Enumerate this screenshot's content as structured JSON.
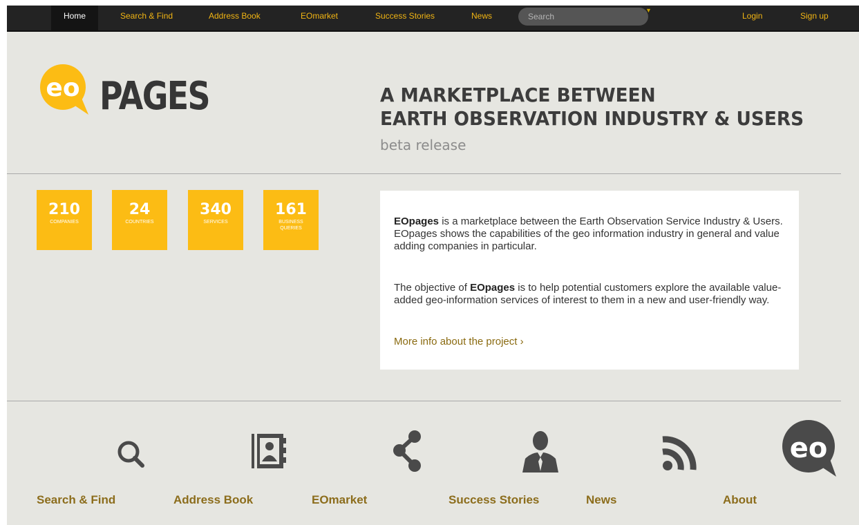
{
  "nav": {
    "items": [
      {
        "label": "Home",
        "active": true
      },
      {
        "label": "Search & Find"
      },
      {
        "label": "Address Book"
      },
      {
        "label": "EOmarket"
      },
      {
        "label": "Success Stories"
      },
      {
        "label": "News"
      }
    ],
    "search_placeholder": "Search",
    "login": "Login",
    "signup": "Sign up"
  },
  "logo": {
    "bubble_text": "eo",
    "wordmark": "PAGES"
  },
  "hero": {
    "headline_1": "A MARKETPLACE BETWEEN",
    "headline_2": "EARTH OBSERVATION INDUSTRY & USERS",
    "subtitle": "beta release"
  },
  "stats": [
    {
      "value": "210",
      "label": "COMPANIES"
    },
    {
      "value": "24",
      "label": "COUNTRIES"
    },
    {
      "value": "340",
      "label": "SERVICES"
    },
    {
      "value": "161",
      "label": "BUSINESS QUERIES"
    }
  ],
  "info": {
    "brand": "EOpages",
    "p1_rest": " is a marketplace between the Earth Observation Service Industry & Users. EOpages shows the capabilities of the geo information industry in general and value adding companies in particular.",
    "p2_start": "The objective of ",
    "p2_rest": " is to help potential customers explore the available value-added geo-information services of interest to them in a new and user-friendly way.",
    "more_link": "More info about the project ›"
  },
  "features": [
    {
      "label": "Search & Find",
      "icon": "search-icon"
    },
    {
      "label": "Address Book",
      "icon": "address-book-icon"
    },
    {
      "label": "EOmarket",
      "icon": "share-icon"
    },
    {
      "label": "Success Stories",
      "icon": "person-icon"
    },
    {
      "label": "News",
      "icon": "rss-icon"
    },
    {
      "label": "About",
      "icon": "eo-logo-icon"
    }
  ],
  "colors": {
    "accent": "#fcbc14",
    "nav_bg": "#232323",
    "link": "#8c6d1c",
    "page_bg": "#e6e6e1"
  }
}
